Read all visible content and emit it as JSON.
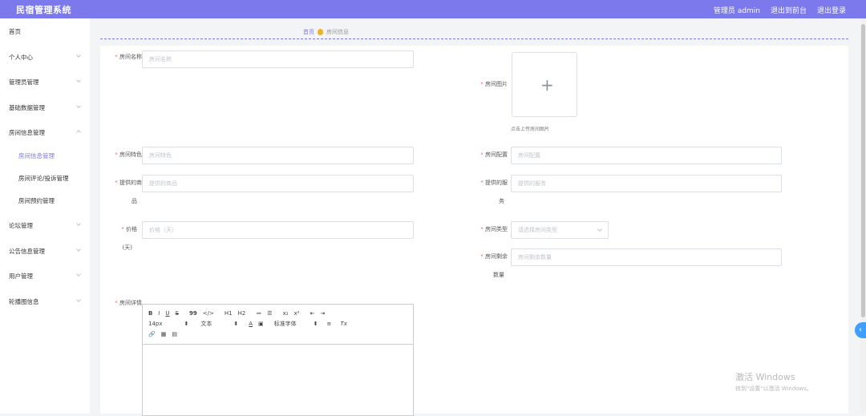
{
  "header": {
    "title": "民宿管理系统",
    "admin_label": "管理员 admin",
    "front_label": "退出到前台",
    "logout_label": "退出登录"
  },
  "sidebar": {
    "items": [
      {
        "label": "首页"
      },
      {
        "label": "个人中心"
      },
      {
        "label": "管理员管理"
      },
      {
        "label": "基础数据管理"
      },
      {
        "label": "房间信息管理"
      },
      {
        "label": "房间信息管理"
      },
      {
        "label": "房间评论/投诉管理"
      },
      {
        "label": "房间预约管理"
      },
      {
        "label": "论坛管理"
      },
      {
        "label": "公告信息管理"
      },
      {
        "label": "用户管理"
      },
      {
        "label": "轮播图信息"
      }
    ]
  },
  "breadcrumb": {
    "home": "首页",
    "current": "房间信息"
  },
  "form": {
    "room_name": {
      "label": "房间名称",
      "placeholder": "房间名称"
    },
    "room_image": {
      "label": "房间图片",
      "tip": "点击上传房间图片"
    },
    "feature": {
      "label": "房间特色",
      "placeholder": "房间特色"
    },
    "config": {
      "label": "房间配置",
      "placeholder": "房间配置"
    },
    "goods": {
      "label_1": "提供的商",
      "label_2": "品",
      "placeholder": "提供的商品"
    },
    "service": {
      "label_1": "提供的服",
      "label_2": "务",
      "placeholder": "提供的服务"
    },
    "price": {
      "label_1": "价格",
      "label_2": "(天)",
      "placeholder": "价格（天）"
    },
    "room_type": {
      "label": "房间类型",
      "placeholder": "请选择房间类型"
    },
    "remaining": {
      "label_1": "房间剩余",
      "label_2": "数量",
      "placeholder": "房间剩余数量"
    },
    "detail": {
      "label": "房间详情"
    }
  },
  "editor": {
    "row1": [
      "B",
      "I",
      "U",
      "S",
      "99",
      "</>",
      "H1",
      "H2",
      "≔",
      "☰",
      "x₂",
      "x²",
      "⇤",
      "⇥"
    ],
    "row2": [
      "14px",
      "⬍",
      "文本",
      "⬍",
      "A",
      "▣",
      "标准字体",
      "⬍",
      "≡",
      "Tx"
    ],
    "row3": [
      "🔗",
      "▦",
      "▤"
    ]
  },
  "watermark": {
    "line1": "激活 Windows",
    "line2": "转到\"设置\"以激活 Windows。"
  },
  "fab": {
    "icon": "‹"
  }
}
